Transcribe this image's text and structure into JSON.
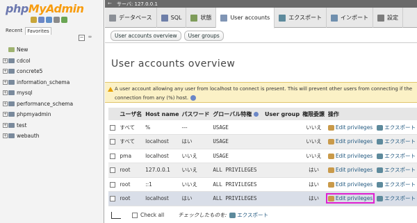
{
  "nav": {
    "logo": {
      "php": "php",
      "my": "My",
      "admin": "Admin"
    },
    "tabs": [
      "Recent",
      "Favorites"
    ],
    "databases": [
      {
        "name": "New",
        "type": "new"
      },
      {
        "name": "cdcol",
        "type": "db"
      },
      {
        "name": "concrete5",
        "type": "db"
      },
      {
        "name": "information_schema",
        "type": "db"
      },
      {
        "name": "mysql",
        "type": "db"
      },
      {
        "name": "performance_schema",
        "type": "db"
      },
      {
        "name": "phpmyadmin",
        "type": "db"
      },
      {
        "name": "test",
        "type": "db"
      },
      {
        "name": "webauth",
        "type": "db"
      }
    ]
  },
  "topbar": {
    "breadcrumb": "サーバ: 127.0.0.1"
  },
  "tabs": [
    {
      "label": "データベース",
      "icon": "database-icon",
      "color": "#8b8f96",
      "active": false
    },
    {
      "label": "SQL",
      "icon": "sql-icon",
      "color": "#6d7ea8",
      "active": false
    },
    {
      "label": "状態",
      "icon": "status-icon",
      "color": "#7e9c5a",
      "active": false
    },
    {
      "label": "User accounts",
      "icon": "users-icon",
      "color": "#8095b5",
      "active": true
    },
    {
      "label": "エクスポート",
      "icon": "export-icon",
      "color": "#5d8a9c",
      "active": false
    },
    {
      "label": "インポート",
      "icon": "import-icon",
      "color": "#6f8fae",
      "active": false
    },
    {
      "label": "設定",
      "icon": "settings-icon",
      "color": "#7b7b7b",
      "active": false
    }
  ],
  "subtabs": [
    "User accounts overview",
    "User groups"
  ],
  "page_title": "User accounts overview",
  "notice": {
    "line1": "A user account allowing any user from localhost to connect is present. This will prevent other users from connecting if the",
    "line2": "connection from any (%) host."
  },
  "table": {
    "headers": [
      "ユーザ名",
      "Host name",
      "パスワード",
      "グローバル特権",
      "User group",
      "権限委譲",
      "操作"
    ],
    "rows": [
      {
        "user": "すべて",
        "user_red": true,
        "host": "%",
        "password": "---",
        "password_red": false,
        "privileges": "USAGE",
        "grant": "いいえ",
        "edit": "Edit privileges",
        "export": "エクスポート"
      },
      {
        "user": "すべて",
        "user_red": true,
        "host": "localhost",
        "password": "はい",
        "password_red": false,
        "privileges": "USAGE",
        "grant": "いいえ",
        "edit": "Edit privileges",
        "export": "エクスポート"
      },
      {
        "user": "pma",
        "user_red": false,
        "host": "localhost",
        "password": "いいえ",
        "password_red": true,
        "privileges": "USAGE",
        "grant": "いいえ",
        "edit": "Edit privileges",
        "export": "エクスポート"
      },
      {
        "user": "root",
        "user_red": false,
        "host": "127.0.0.1",
        "password": "いいえ",
        "password_red": true,
        "privileges": "ALL PRIVILEGES",
        "grant": "はい",
        "edit": "Edit privileges",
        "export": "エクスポート"
      },
      {
        "user": "root",
        "user_red": false,
        "host": "::1",
        "password": "いいえ",
        "password_red": true,
        "privileges": "ALL PRIVILEGES",
        "grant": "はい",
        "edit": "Edit privileges",
        "export": "エクスポート"
      },
      {
        "user": "root",
        "user_red": false,
        "host": "localhost",
        "password": "はい",
        "password_red": false,
        "privileges": "ALL PRIVILEGES",
        "grant": "はい",
        "edit": "Edit privileges",
        "export": "エクスポート"
      }
    ]
  },
  "footer": {
    "check_all": "Check all",
    "with_selected": "チェックしたものを:",
    "export": "エクスポート"
  }
}
